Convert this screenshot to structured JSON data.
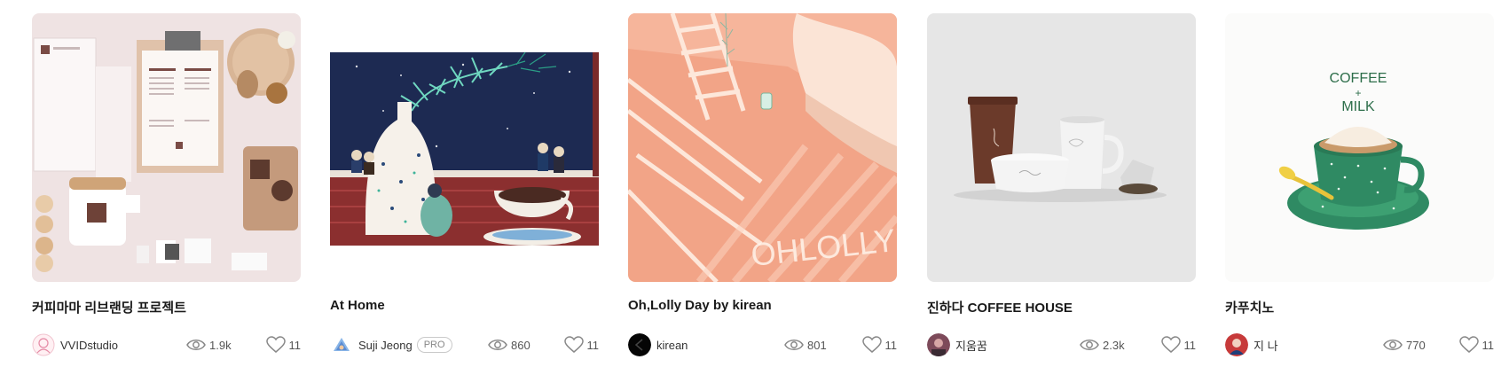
{
  "cards": [
    {
      "title": "커피마마 리브랜딩 프로젝트",
      "author": "VVIDstudio",
      "pro": "",
      "views": "1.9k",
      "likes": "11",
      "avatar_icon": "sketch-avatar",
      "accent": "#eee3e3"
    },
    {
      "title": "At Home",
      "author": "Suji Jeong",
      "pro": "PRO",
      "views": "860",
      "likes": "11",
      "avatar_icon": "triangle-avatar",
      "accent": "#a33a35"
    },
    {
      "title": "Oh,Lolly Day by kirean",
      "author": "kirean",
      "pro": "",
      "views": "801",
      "likes": "11",
      "avatar_icon": "dark-avatar",
      "accent": "#f3a589"
    },
    {
      "title": "진하다 COFFEE HOUSE",
      "author": "지움꿈",
      "pro": "",
      "views": "2.3k",
      "likes": "11",
      "avatar_icon": "photo-avatar",
      "accent": "#e8e8e8"
    },
    {
      "title": "카푸치노",
      "author": "지 나",
      "pro": "",
      "views": "770",
      "likes": "11",
      "avatar_icon": "red-avatar",
      "accent": "#2f8a63",
      "illustration_text": [
        "COFFEE",
        "+",
        "MILK"
      ]
    }
  ]
}
